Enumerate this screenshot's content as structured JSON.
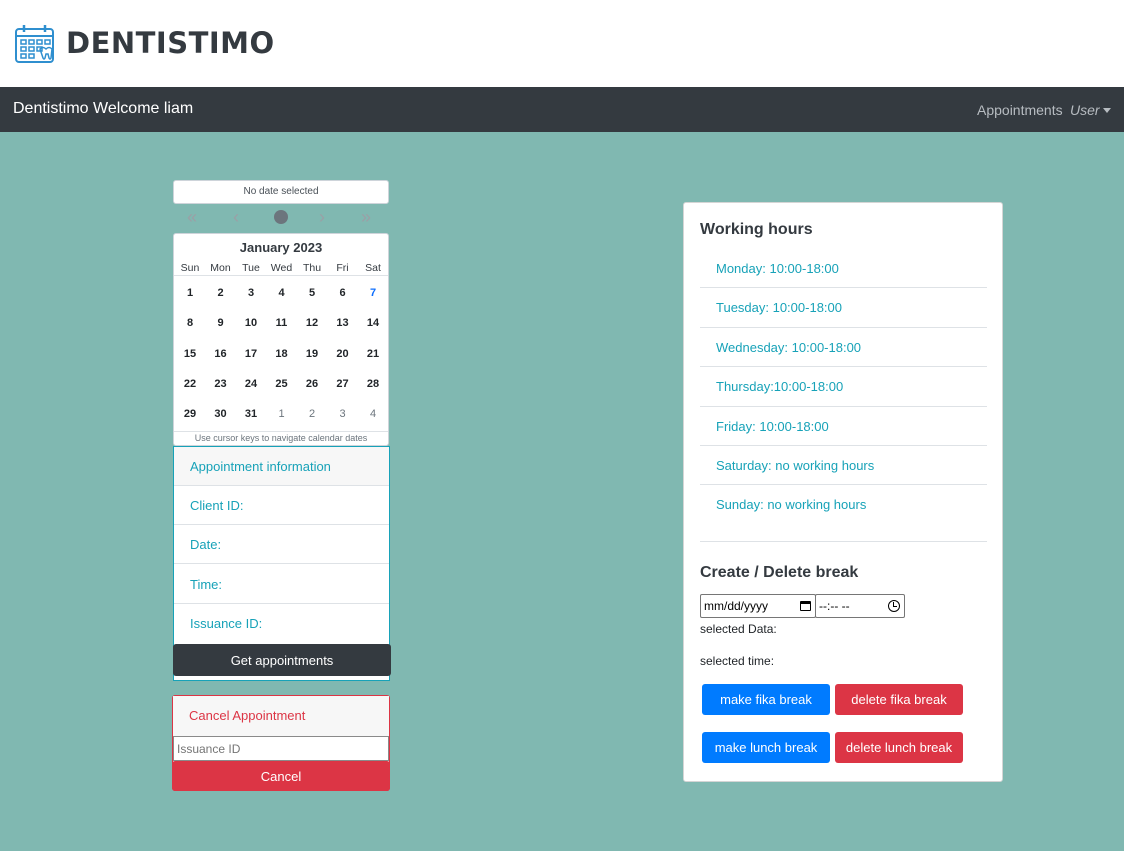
{
  "brand": {
    "logo_text": "DENTISTIMO",
    "logo_icon": "calendar-tooth-icon"
  },
  "navbar": {
    "title": "Dentistimo Welcome liam",
    "links": {
      "appointments": "Appointments",
      "user": "User"
    }
  },
  "datepicker": {
    "selected_label": "No date selected",
    "nav": {
      "prev_year": "«",
      "prev_month": "‹",
      "next_month": "›",
      "next_year": "»"
    },
    "month_title": "January 2023",
    "weekdays": [
      "Sun",
      "Mon",
      "Tue",
      "Wed",
      "Thu",
      "Fri",
      "Sat"
    ],
    "weeks": [
      [
        "1",
        "2",
        "3",
        "4",
        "5",
        "6",
        "7"
      ],
      [
        "8",
        "9",
        "10",
        "11",
        "12",
        "13",
        "14"
      ],
      [
        "15",
        "16",
        "17",
        "18",
        "19",
        "20",
        "21"
      ],
      [
        "22",
        "23",
        "24",
        "25",
        "26",
        "27",
        "28"
      ],
      [
        "29",
        "30",
        "31",
        "1",
        "2",
        "3",
        "4"
      ]
    ],
    "hint": "Use cursor keys to navigate calendar dates"
  },
  "appointment_info": {
    "header": "Appointment information",
    "client_id": "Client ID:",
    "date": "Date:",
    "time": "Time:",
    "issuance_id": "Issuance ID:",
    "get_button": "Get appointments"
  },
  "cancel": {
    "header": "Cancel Appointment",
    "input_placeholder": "Issuance ID",
    "button": "Cancel"
  },
  "working_hours": {
    "title": "Working hours",
    "items": [
      "Monday: 10:00-18:00",
      "Tuesday: 10:00-18:00",
      "Wednesday: 10:00-18:00",
      "Thursday:10:00-18:00",
      "Friday: 10:00-18:00",
      "Saturday: no working hours",
      "Sunday: no working hours"
    ]
  },
  "breaks": {
    "title": "Create / Delete break",
    "date_placeholder": "mm/dd/yyyy",
    "time_placeholder": "--:-- --",
    "selected_date_label": "selected Data:",
    "selected_time_label": "selected time:",
    "make_fika": "make fika break",
    "delete_fika": "delete fika break",
    "make_lunch": "make lunch break",
    "delete_lunch": "delete lunch break"
  },
  "colors": {
    "background": "#80b8b1",
    "navbar": "#343a40",
    "accent_teal": "#17a2b8",
    "primary": "#007bff",
    "danger": "#dc3545"
  }
}
